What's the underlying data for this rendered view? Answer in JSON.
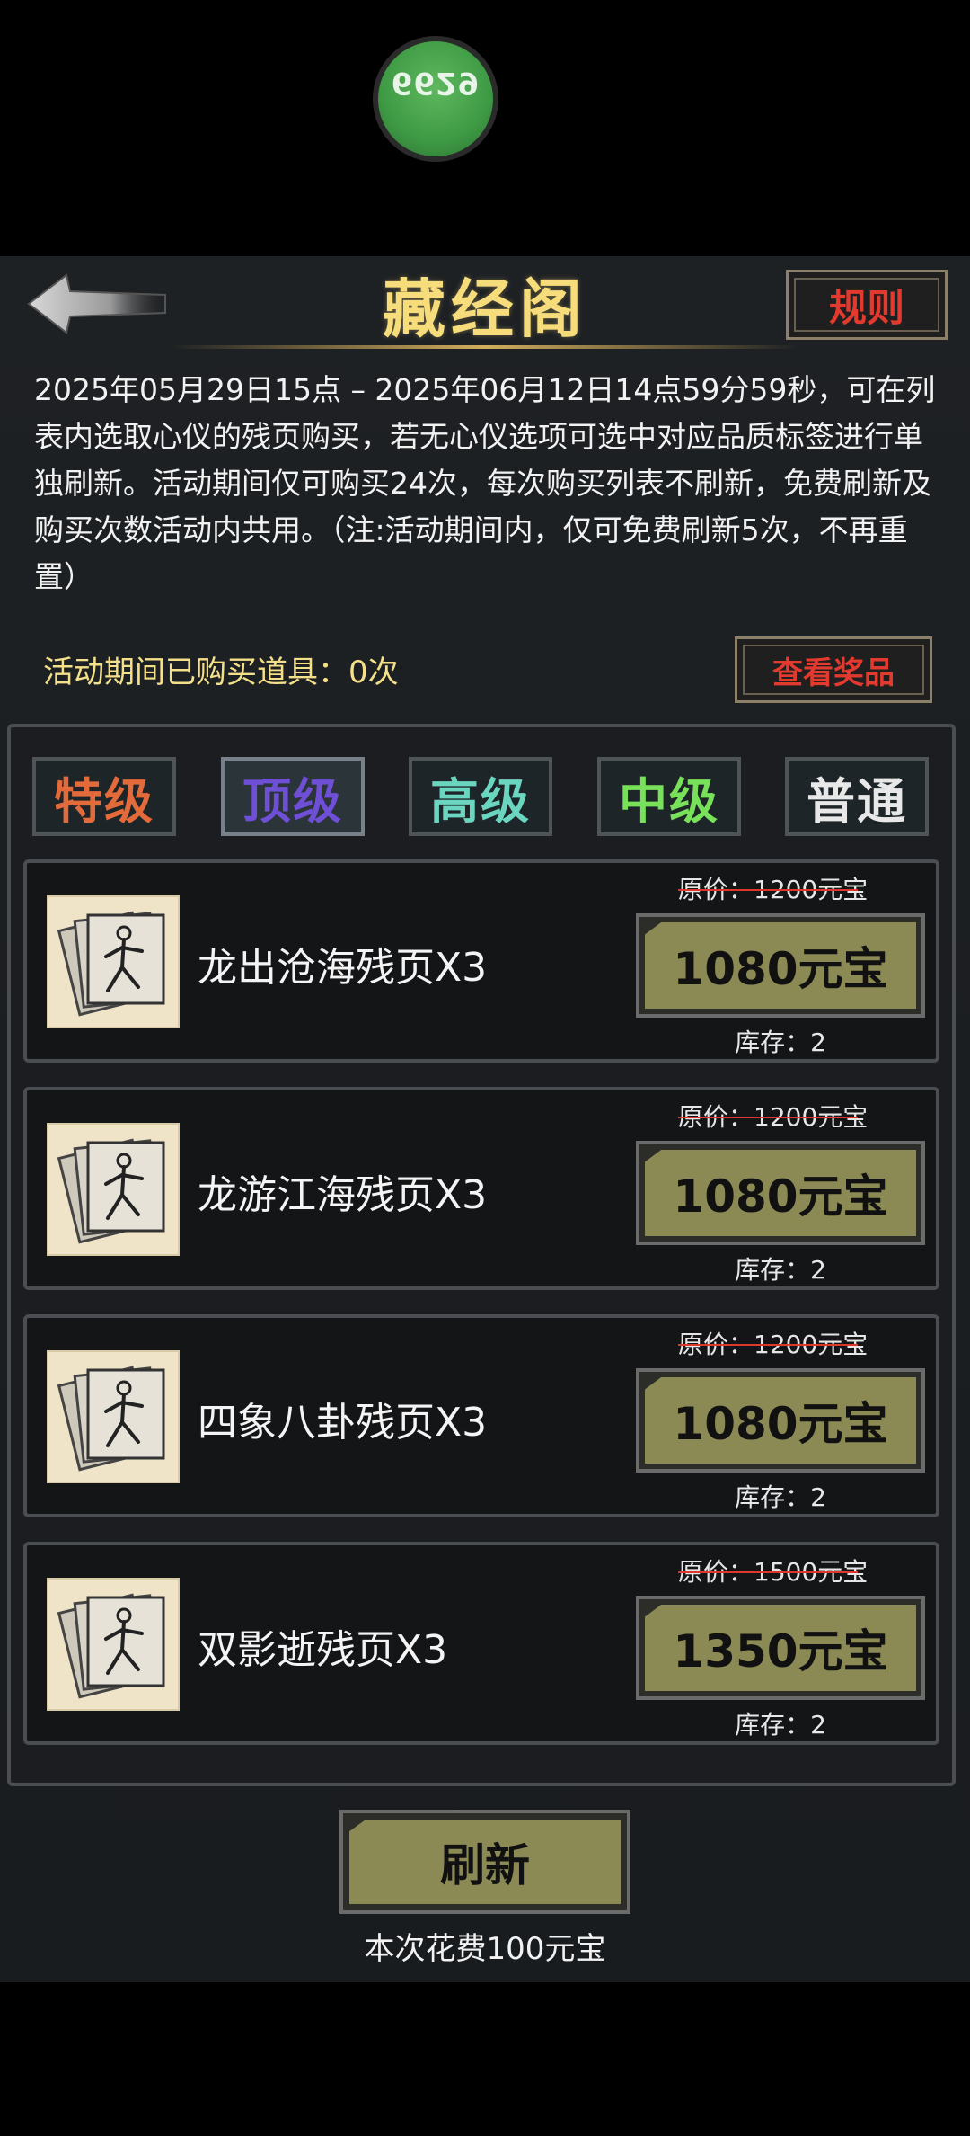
{
  "status_badge": "6629",
  "header": {
    "title": "藏经阁",
    "rules_label": "规则"
  },
  "description": "2025年05月29日15点 – 2025年06月12日14点59分59秒，可在列表内选取心仪的残页购买，若无心仪选项可选中对应品质标签进行单独刷新。活动期间仅可购买24次，每次购买列表不刷新，免费刷新及购买次数活动内共用。（注:活动期间内，仅可免费刷新5次，不再重置）",
  "purchase_info": {
    "text": "活动期间已购买道具：0次",
    "view_rewards_label": "查看奖品"
  },
  "tabs": [
    {
      "label": "特级",
      "color": "#e36a3a",
      "selected": false
    },
    {
      "label": "顶级",
      "color": "#6e4fd6",
      "selected": true
    },
    {
      "label": "高级",
      "color": "#6bd6c0",
      "selected": false
    },
    {
      "label": "中级",
      "color": "#78e05a",
      "selected": false
    },
    {
      "label": "普通",
      "color": "#e8e8e8",
      "selected": false
    }
  ],
  "items": [
    {
      "name": "龙出沧海残页X3",
      "original_price": "原价：1200元宝",
      "price": "1080元宝",
      "stock": "库存：2"
    },
    {
      "name": "龙游江海残页X3",
      "original_price": "原价：1200元宝",
      "price": "1080元宝",
      "stock": "库存：2"
    },
    {
      "name": "四象八卦残页X3",
      "original_price": "原价：1200元宝",
      "price": "1080元宝",
      "stock": "库存：2"
    },
    {
      "name": "双影逝残页X3",
      "original_price": "原价：1500元宝",
      "price": "1350元宝",
      "stock": "库存：2"
    }
  ],
  "footer": {
    "refresh_label": "刷新",
    "cost_text": "本次花费100元宝"
  }
}
